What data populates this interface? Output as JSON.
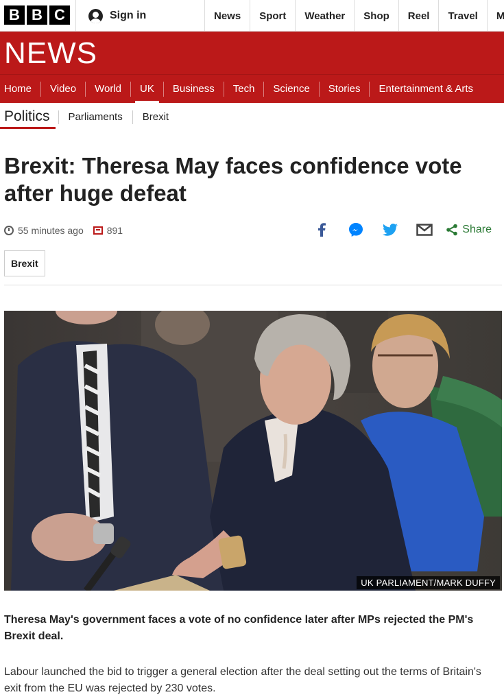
{
  "brand": {
    "letters": [
      "B",
      "B",
      "C"
    ]
  },
  "account": {
    "signin_label": "Sign in"
  },
  "topnav": [
    "News",
    "Sport",
    "Weather",
    "Shop",
    "Reel",
    "Travel",
    "M"
  ],
  "news_wordmark": "NEWS",
  "section_nav": {
    "items": [
      "Home",
      "Video",
      "World",
      "UK",
      "Business",
      "Tech",
      "Science",
      "Stories",
      "Entertainment & Arts"
    ],
    "active": "UK"
  },
  "sub_nav": {
    "primary": "Politics",
    "items": [
      "Parliaments",
      "Brexit"
    ]
  },
  "article": {
    "headline": "Brexit: Theresa May faces confidence vote after huge defeat",
    "timestamp": "55 minutes ago",
    "comment_count": "891",
    "share_label": "Share",
    "share_icons": [
      "facebook-icon",
      "messenger-icon",
      "twitter-icon",
      "email-icon",
      "share-icon"
    ],
    "tag": "Brexit",
    "image_caption": "UK PARLIAMENT/MARK DUFFY",
    "intro": "Theresa May's government faces a vote of no confidence later after MPs rejected the PM's Brexit deal.",
    "paragraph_1": "Labour launched the bid to trigger a general election after the deal setting out the terms of Britain's exit from the EU was rejected by 230 votes."
  },
  "colors": {
    "brand_red": "#bb1919",
    "share_green": "#2b7a35",
    "facebook": "#3b5998",
    "twitter": "#1da1f2",
    "messenger": "#0084ff"
  }
}
